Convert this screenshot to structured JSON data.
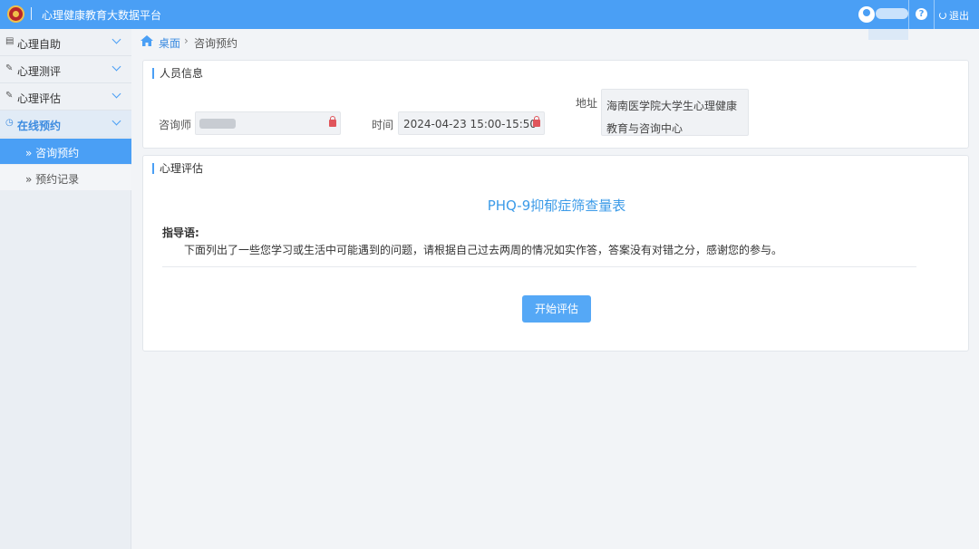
{
  "app": {
    "title": "心理健康教育大数据平台"
  },
  "topbar": {
    "help_glyph": "?",
    "logout_label": "退出"
  },
  "sidebar": {
    "items": [
      {
        "label": "心理自助",
        "icon": "book-icon"
      },
      {
        "label": "心理测评",
        "icon": "edit-icon"
      },
      {
        "label": "心理评估",
        "icon": "edit-icon"
      },
      {
        "label": "在线预约",
        "icon": "clock-icon",
        "active": true
      }
    ],
    "sub_items": [
      {
        "label": "» 咨询预约",
        "selected": true
      },
      {
        "label": "» 预约记录",
        "selected": false
      }
    ]
  },
  "breadcrumb": {
    "home": "桌面",
    "separator": "›",
    "current": "咨询预约"
  },
  "person_card": {
    "title": "人员信息",
    "counselor_label": "咨询师",
    "time_label": "时间",
    "time_value": "2024-04-23 15:00-15:50",
    "address_label": "地址",
    "address_value": "海南医学院大学生心理健康教育与咨询中心"
  },
  "assessment_card": {
    "title": "心理评估",
    "form_title": "PHQ-9抑郁症筛查量表",
    "guide_label": "指导语:",
    "guide_text": "下面列出了一些您学习或生活中可能遇到的问题，请根据自己过去两周的情况如实作答，答案没有对错之分，感谢您的参与。",
    "start_button": "开始评估"
  },
  "colors": {
    "primary": "#4a9ff5",
    "title_blue": "#3c9be8",
    "lock_red": "#e0555b"
  }
}
